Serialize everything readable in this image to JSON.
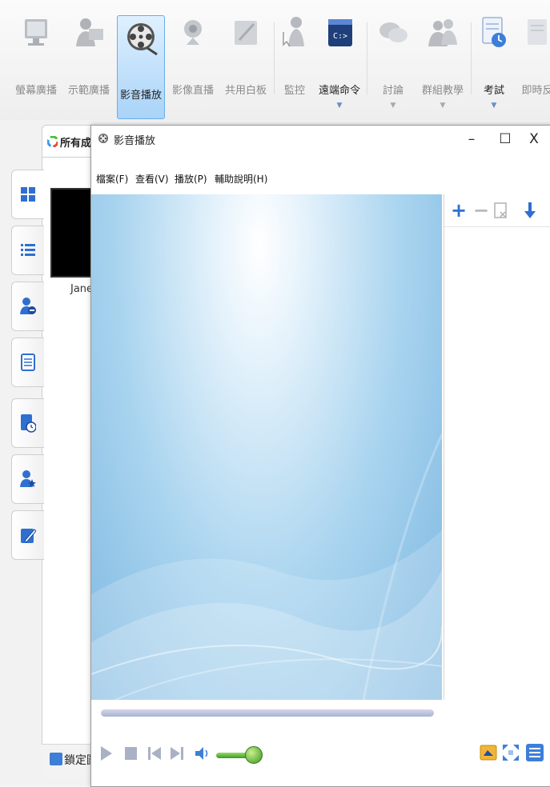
{
  "toolbar": {
    "items": [
      {
        "label": "螢幕廣播",
        "icon": "screen-broadcast-icon"
      },
      {
        "label": "示範廣播",
        "icon": "demo-broadcast-icon"
      },
      {
        "label": "影音播放",
        "icon": "film-reel-icon",
        "active": true
      },
      {
        "label": "影像直播",
        "icon": "webcam-icon"
      },
      {
        "label": "共用白板",
        "icon": "whiteboard-icon"
      },
      {
        "label": "監控",
        "icon": "monitor-icon"
      },
      {
        "label": "遠端命令",
        "icon": "command-prompt-icon"
      },
      {
        "label": "討論",
        "icon": "chat-bubbles-icon"
      },
      {
        "label": "群組教學",
        "icon": "group-teaching-icon"
      },
      {
        "label": "考試",
        "icon": "exam-clock-icon"
      },
      {
        "label": "即時反",
        "icon": "instant-feedback-icon"
      }
    ]
  },
  "side": {
    "panel_tab": "所有成員",
    "thumb_name": "Jane",
    "lock_label": "鎖定圖示"
  },
  "player": {
    "title": "影音播放",
    "controls": {
      "minimize": "–",
      "maximize": "☐",
      "close": "X"
    },
    "menu": [
      "檔案(F)",
      "查看(V)",
      "播放(P)",
      "輔助說明(H)"
    ]
  },
  "colors": {
    "accent": "#3d7fd8",
    "video_light": "#e4f2fb",
    "video_dark": "#7cb6e0",
    "volume_green": "#3a9a22"
  }
}
